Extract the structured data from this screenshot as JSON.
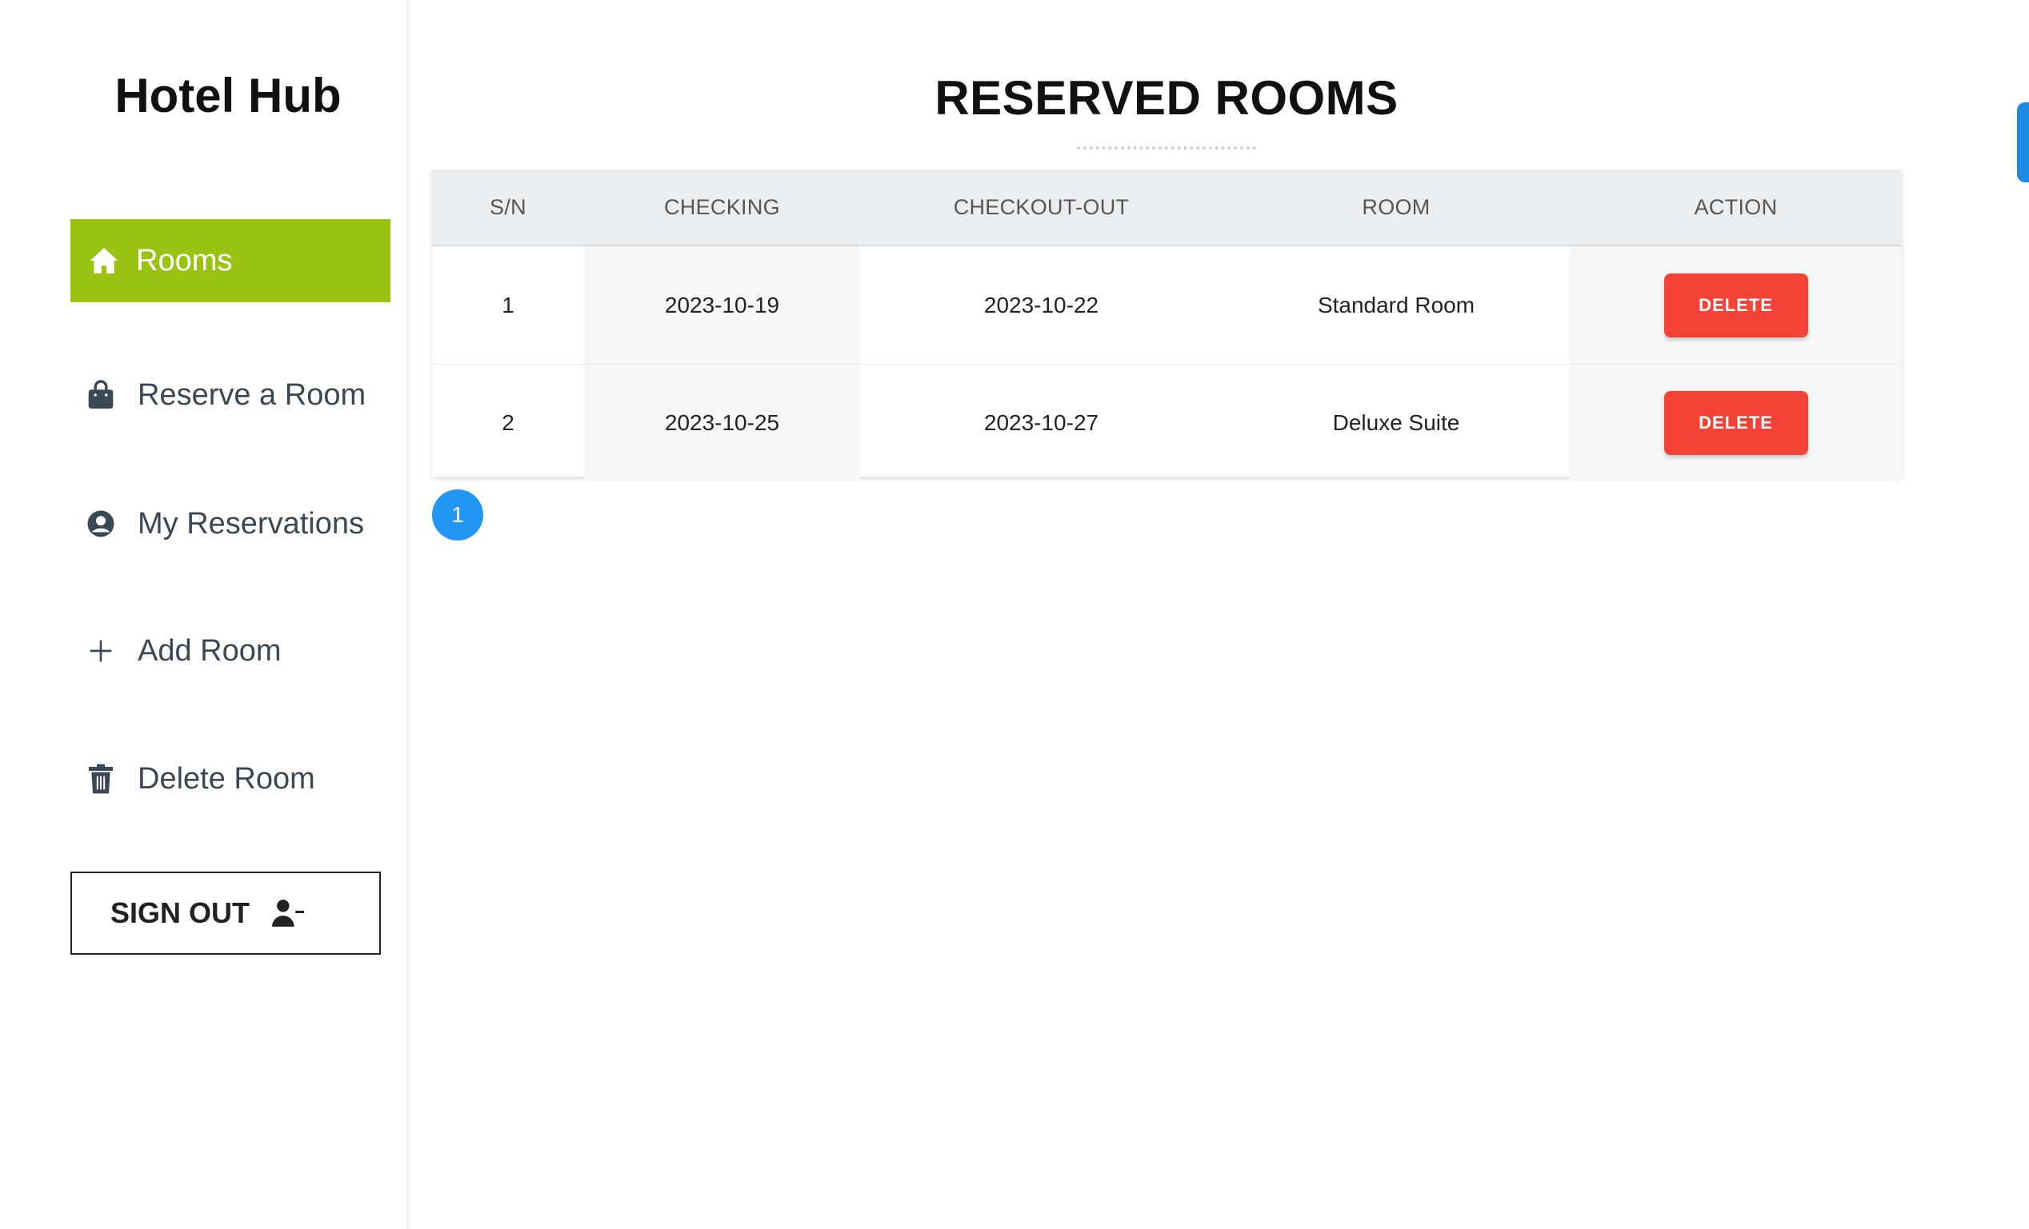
{
  "sidebar": {
    "brand": "Hotel Hub",
    "items": [
      {
        "label": "Rooms",
        "icon": "home-icon",
        "active": true
      },
      {
        "label": "Reserve a Room",
        "icon": "shopping-bag-icon",
        "active": false
      },
      {
        "label": "My Reservations",
        "icon": "user-circle-icon",
        "active": false
      },
      {
        "label": "Add Room",
        "icon": "plus-icon",
        "active": false
      },
      {
        "label": "Delete Room",
        "icon": "trash-icon",
        "active": false
      }
    ],
    "signout_label": "SIGN OUT",
    "signout_icon": "user-minus-icon"
  },
  "main": {
    "title": "RESERVED ROOMS",
    "columns": [
      "S/N",
      "CHECKING",
      "CHECKOUT-OUT",
      "ROOM",
      "ACTION"
    ],
    "rows": [
      {
        "sn": "1",
        "checkin": "2023-10-19",
        "checkout": "2023-10-22",
        "room": "Standard Room",
        "action": "DELETE"
      },
      {
        "sn": "2",
        "checkin": "2023-10-25",
        "checkout": "2023-10-27",
        "room": "Deluxe Suite",
        "action": "DELETE"
      }
    ],
    "pagination": {
      "current_page": "1"
    }
  },
  "colors": {
    "accent": "#9ac212",
    "danger": "#f44336",
    "primary": "#2196f3"
  }
}
